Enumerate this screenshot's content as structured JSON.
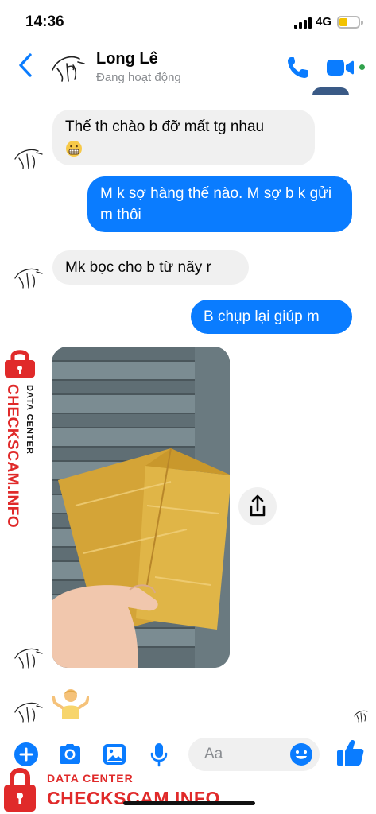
{
  "status_bar": {
    "time": "14:36",
    "network": "4G",
    "battery_level": 0.45
  },
  "header": {
    "contact_name": "Long Lê",
    "status": "Đang hoạt động",
    "back_icon": "chevron-left-icon",
    "call_icon": "phone-icon",
    "video_icon": "video-camera-icon",
    "accent": "#0a7cff",
    "online_color": "#31a24c"
  },
  "messages": [
    {
      "from": "them",
      "text": "Thế th chào b đỡ mất tg nhau",
      "emoji": "grimacing-face"
    },
    {
      "from": "me",
      "text": "M k sợ hàng thế nào. M sợ b k gửi m thôi"
    },
    {
      "from": "them",
      "text": "Mk bọc cho b từ nãy r"
    },
    {
      "from": "me",
      "text": "B chụp lại giúp m"
    },
    {
      "from": "them",
      "type": "photo",
      "description_icon": "photo-attachment"
    },
    {
      "from": "them",
      "type": "sticker",
      "emoji": "person-shrugging"
    }
  ],
  "composer": {
    "placeholder": "Aa",
    "icons": [
      "add-icon",
      "camera-icon",
      "gallery-icon",
      "microphone-icon",
      "emoji-icon",
      "like-icon"
    ]
  },
  "watermark": {
    "label_top": "DATA CENTER",
    "brand": "CHECKSCAM.INFO",
    "color": "#e02a2a"
  }
}
